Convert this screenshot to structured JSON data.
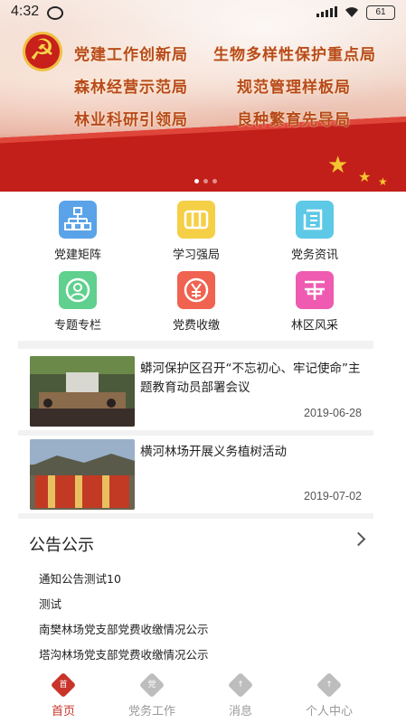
{
  "status_bar": {
    "time": "4:32",
    "battery": "61"
  },
  "banner": {
    "slogans": [
      "党建工作创新局",
      "生物多样性保护重点局",
      "森林经营示范局",
      "规范管理样板局",
      "林业科研引领局",
      "良种繁育先导局"
    ]
  },
  "menu": [
    {
      "label": "党建矩阵",
      "icon": "hierarchy-icon",
      "color": "#5aa3e8"
    },
    {
      "label": "学习强局",
      "icon": "book-icon",
      "color": "#f5cf46"
    },
    {
      "label": "党务资讯",
      "icon": "newspaper-icon",
      "color": "#5dc9e6"
    },
    {
      "label": "专题专栏",
      "icon": "user-circle-icon",
      "color": "#5fd08d"
    },
    {
      "label": "党费收缴",
      "icon": "yen-icon",
      "color": "#ef6350"
    },
    {
      "label": "林区风采",
      "icon": "scenery-icon",
      "color": "#ee5bb0"
    }
  ],
  "news": [
    {
      "title": "蟒河保护区召开“不忘初心、牢记使命”主题教育动员部署会议",
      "date": "2019-06-28"
    },
    {
      "title": "横河林场开展义务植树活动",
      "date": "2019-07-02"
    }
  ],
  "notices": {
    "title": "公告公示",
    "items": [
      "通知公告测试10",
      "测试",
      "南樊林场党支部党费收缴情况公示",
      "塔沟林场党支部党费收缴情况公示"
    ]
  },
  "tabs": [
    {
      "label": "首页",
      "glyph": "首",
      "active": true
    },
    {
      "label": "党务工作",
      "glyph": "党",
      "active": false
    },
    {
      "label": "消息",
      "glyph": "↑",
      "active": false
    },
    {
      "label": "个人中心",
      "glyph": "↑",
      "active": false
    }
  ],
  "colors": {
    "active_tab": "#c8342a",
    "inactive_tab": "#999999"
  }
}
